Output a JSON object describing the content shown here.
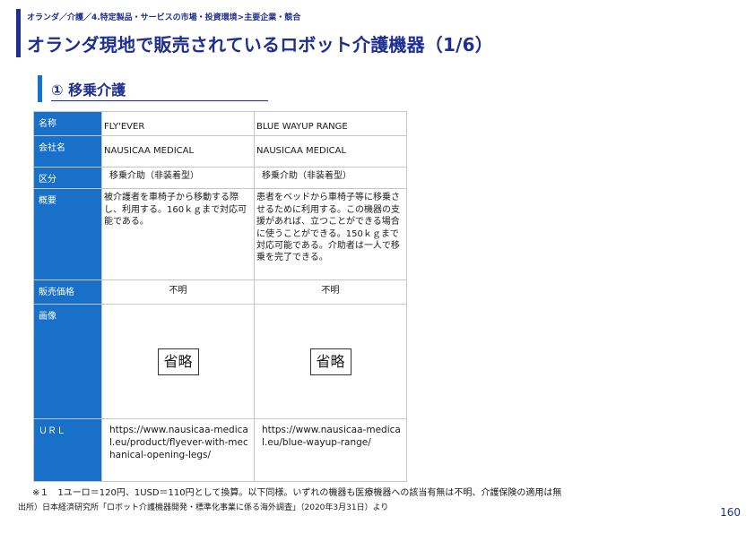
{
  "header": {
    "breadcrumb": "オランダ／介護／4.特定製品・サービスの市場・投資環境>主要企業・競合",
    "title": "オランダ現地で販売されているロボット介護機器（1/6）"
  },
  "section": {
    "title": "① 移乗介護"
  },
  "table": {
    "row_labels": {
      "name": "名称",
      "company": "会社名",
      "category": "区分",
      "overview": "概要",
      "price": "販売価格",
      "image": "画像",
      "url": "ＵＲＬ"
    },
    "products": [
      {
        "name": "FLY'EVER",
        "company": "NAUSICAA MEDICAL",
        "category": "移乗介助（非装着型）",
        "overview": "被介護者を車椅子から移動する際し、利用する。160ｋｇまで対応可能である。",
        "price": "不明",
        "image": "省略",
        "url": "https://www.nausicaa-medical.eu/product/flyever-with-mechanical-opening-legs/"
      },
      {
        "name": "BLUE WAYUP RANGE",
        "company": "NAUSICAA MEDICAL",
        "category": "移乗介助（非装着型）",
        "overview": "患者をベッドから車椅子等に移乗させるために利用する。この機器の支援があれば、立つことができる場合に使うことができる。150ｋｇまで対応可能である。介助者は一人で移乗を完了できる。",
        "price": "不明",
        "image": "省略",
        "url": "https://www.nausicaa-medical.eu/blue-wayup-range/"
      }
    ]
  },
  "footnote": "※１　1ユーロ＝120円、1USD＝110円として換算。以下同様。いずれの機器も医療機器への該当有無は不明、介護保険の適用は無",
  "source": "出所）日本経済研究所「ロボット介護機器開発・標準化事業に係る海外調査」（2020年3月31日）より",
  "page_number": "160",
  "colors": {
    "navy": "#1f2f8f",
    "label_blue": "#1870c9"
  }
}
